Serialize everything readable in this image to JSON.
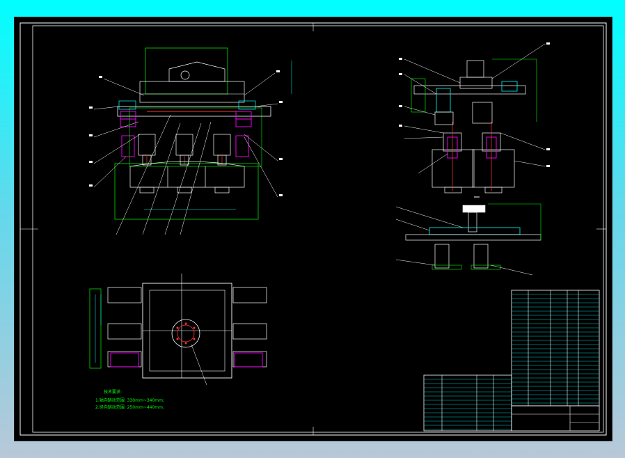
{
  "tech_notes": {
    "title": "技术要求:",
    "line1": "1.轴向跳动范围: 330mm~340mm;",
    "line2": "2.径向跳动范围: 250mm~440mm."
  },
  "colors": {
    "background": "#000000",
    "frame": "#ffffff",
    "outline": "#00ff00",
    "part": "#ffffff",
    "cylinder": "#ff00ff",
    "flange": "#ff3333",
    "block": "#00ffff",
    "dimension": "#00ffff",
    "title_block_text": "#ffffff"
  },
  "icons": [
    "front-view",
    "side-view",
    "section-view",
    "top-view",
    "parts-list",
    "title-block"
  ]
}
